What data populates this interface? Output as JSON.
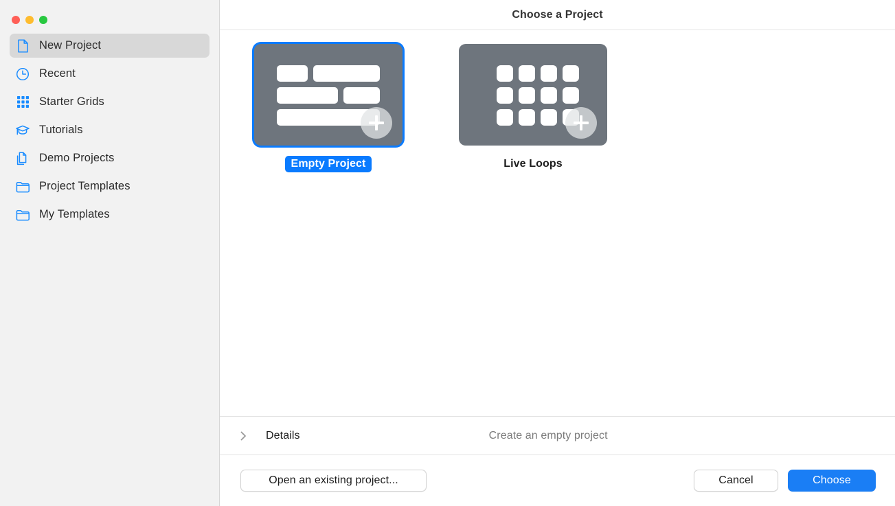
{
  "window": {
    "title": "Choose a Project",
    "traffic_lights": [
      {
        "name": "close",
        "color": "#ff5f57"
      },
      {
        "name": "minimize",
        "color": "#febc2e"
      },
      {
        "name": "zoom",
        "color": "#28c840"
      }
    ]
  },
  "sidebar": {
    "items": [
      {
        "label": "New Project",
        "icon": "document-icon",
        "selected": true
      },
      {
        "label": "Recent",
        "icon": "clock-icon",
        "selected": false
      },
      {
        "label": "Starter Grids",
        "icon": "grid-icon",
        "selected": false
      },
      {
        "label": "Tutorials",
        "icon": "graduation-cap-icon",
        "selected": false
      },
      {
        "label": "Demo Projects",
        "icon": "documents-icon",
        "selected": false
      },
      {
        "label": "Project Templates",
        "icon": "folder-icon",
        "selected": false
      },
      {
        "label": "My Templates",
        "icon": "folder-icon",
        "selected": false
      }
    ]
  },
  "main": {
    "tiles": [
      {
        "label": "Empty Project",
        "artwork": "track-bars",
        "badge": "plus-icon",
        "selected": true
      },
      {
        "label": "Live Loops",
        "artwork": "loop-grid",
        "badge": "plus-icon",
        "selected": false
      }
    ]
  },
  "details": {
    "disclosure_icon": "chevron-right-icon",
    "label": "Details",
    "description": "Create an empty project"
  },
  "footer": {
    "open_label": "Open an existing project...",
    "cancel_label": "Cancel",
    "choose_label": "Choose"
  },
  "colors": {
    "accent": "#0a7bff",
    "primary_button": "#1a7ef5",
    "tile_background": "#6e757d",
    "sidebar_background": "#f2f2f2",
    "selected_row": "#d8d8d8",
    "icon_blue": "#1a8cff"
  }
}
